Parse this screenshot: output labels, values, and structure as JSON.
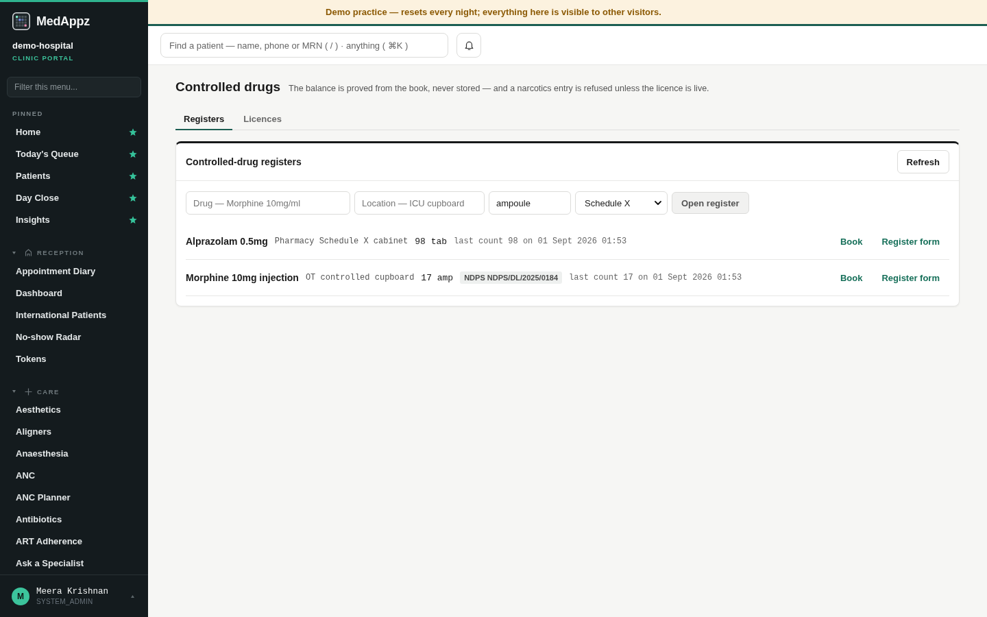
{
  "banner": {
    "text": "Demo practice — resets every night; everything here is visible to other visitors."
  },
  "sidebar": {
    "brand": "MedAppz",
    "org": "demo-hospital",
    "portal": "CLINIC PORTAL",
    "filter": {
      "placeholder": "Filter this menu..."
    },
    "sections": [
      {
        "kind": "pinned",
        "label": "PINNED",
        "items": [
          {
            "label": "Home",
            "starred": true
          },
          {
            "label": "Today's Queue",
            "starred": true
          },
          {
            "label": "Patients",
            "starred": true
          },
          {
            "label": "Day Close",
            "starred": true
          },
          {
            "label": "Insights",
            "starred": true
          }
        ]
      },
      {
        "kind": "group",
        "label": "RECEPTION",
        "expanded": true,
        "items": [
          {
            "label": "Appointment Diary"
          },
          {
            "label": "Dashboard"
          },
          {
            "label": "International Patients"
          },
          {
            "label": "No-show Radar"
          },
          {
            "label": "Tokens"
          }
        ]
      },
      {
        "kind": "group",
        "label": "CARE",
        "expanded": true,
        "items": [
          {
            "label": "Aesthetics"
          },
          {
            "label": "Aligners"
          },
          {
            "label": "Anaesthesia"
          },
          {
            "label": "ANC"
          },
          {
            "label": "ANC Planner"
          },
          {
            "label": "Antibiotics"
          },
          {
            "label": "ART Adherence"
          },
          {
            "label": "Ask a Specialist"
          }
        ]
      }
    ],
    "user": {
      "initial": "M",
      "name": "Meera Krishnan",
      "role": "SYSTEM_ADMIN"
    }
  },
  "topbar": {
    "search": {
      "placeholder": "Find a patient — name, phone or MRN ( / ) · anything ( ⌘K )"
    }
  },
  "page": {
    "title": "Controlled drugs",
    "description": "The balance is proved from the book, never stored — and a narcotics entry is refused unless the licence is live.",
    "tabs": [
      {
        "label": "Registers",
        "selected": true
      },
      {
        "label": "Licences",
        "selected": false
      }
    ],
    "card": {
      "title": "Controlled-drug registers",
      "refresh": "Refresh",
      "form": {
        "fields": [
          {
            "kind": "input",
            "placeholder": "Drug — Morphine 10mg/ml"
          },
          {
            "kind": "input",
            "placeholder": "Location — ICU cupboard"
          },
          {
            "kind": "input",
            "value": "ampoule"
          },
          {
            "kind": "select",
            "value": "Schedule X"
          }
        ],
        "submit": {
          "label": "Open register",
          "disabled": true
        }
      },
      "rows": [
        {
          "name": "Alprazolam 0.5mg",
          "location": "Pharmacy Schedule X cabinet",
          "balance": "98 tab",
          "last_count": "last count 98 on 01 Sept 2026 01:53",
          "actions": [
            "Book",
            "Register form"
          ]
        },
        {
          "name": "Morphine 10mg injection",
          "location": "OT controlled cupboard",
          "balance": "17 amp",
          "licence": "NDPS NDPS/DL/2025/0184",
          "last_count": "last count 17 on 01 Sept 2026 01:53",
          "actions": [
            "Book",
            "Register form"
          ]
        }
      ]
    }
  }
}
